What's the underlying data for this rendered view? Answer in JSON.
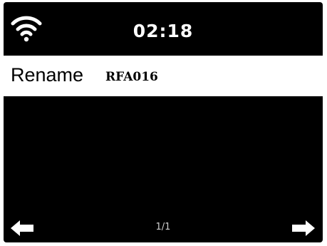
{
  "status_bar": {
    "wifi_icon": "wifi-icon",
    "time": "02:18"
  },
  "menu": {
    "items": [
      {
        "label": "Rename",
        "value": "RFA016",
        "selected": true
      }
    ]
  },
  "footer": {
    "page_indicator": "1/1",
    "left_icon": "arrow-left-icon",
    "right_icon": "arrow-right-icon"
  },
  "colors": {
    "screen_background": "#000000",
    "selection_background": "#ffffff",
    "text_light": "#ffffff",
    "text_dark": "#000000"
  }
}
